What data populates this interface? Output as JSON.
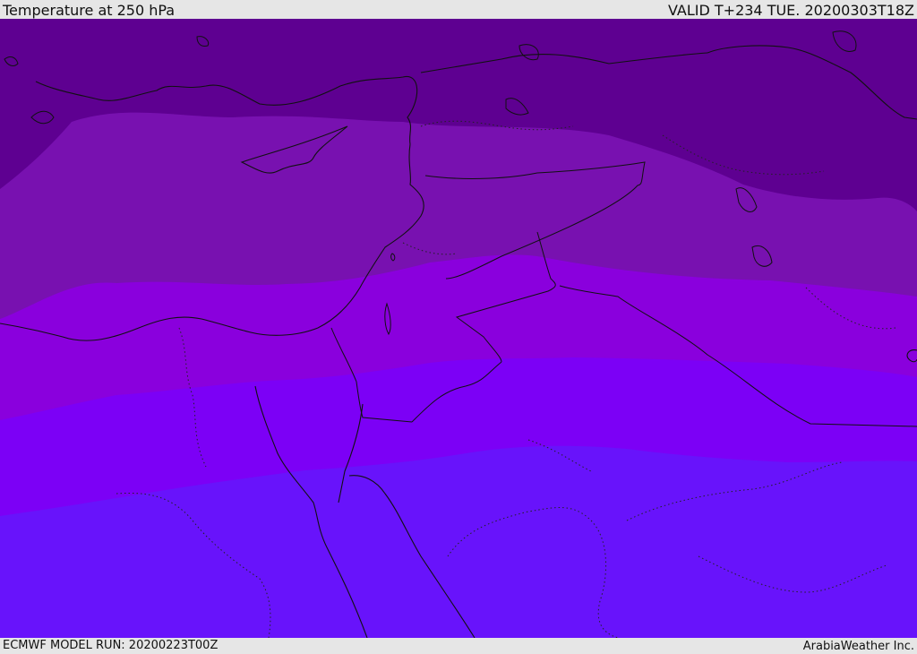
{
  "header": {
    "title": "Temperature at 250 hPa",
    "valid_time": "VALID T+234 TUE. 20200303T18Z"
  },
  "footer": {
    "model_run": "ECMWF MODEL RUN: 20200223T00Z",
    "credit": "ArabiaWeather Inc."
  },
  "map": {
    "region": "Eastern Mediterranean / Middle East",
    "temperature_band_colors": [
      "#5e0091",
      "#7811b0",
      "#8a00dd",
      "#7c00f6",
      "#6813fb"
    ],
    "coastline_color": "#111111",
    "border_style": "dotted",
    "colorbar": "none"
  }
}
